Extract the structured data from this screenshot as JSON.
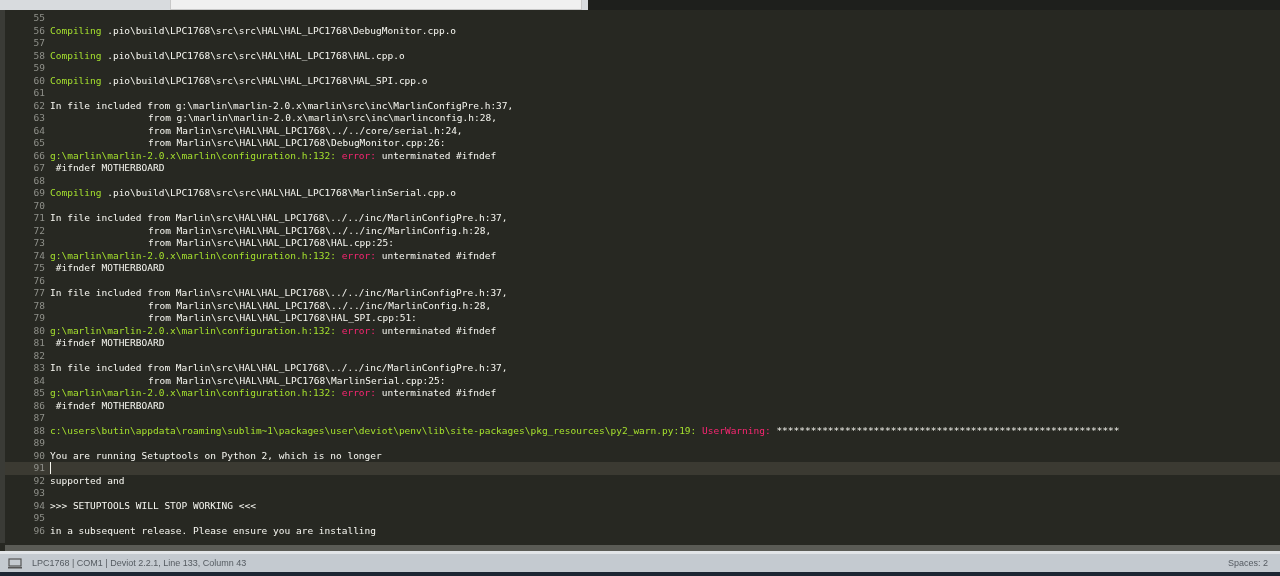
{
  "lines": [
    {
      "number": "55"
    },
    {
      "number": "56",
      "segments": [
        {
          "kind": "keyword",
          "text": "Compiling"
        },
        {
          "kind": "plain",
          "text": " .pio\\build\\LPC1768\\src\\src\\HAL\\HAL_LPC1768\\DebugMonitor.cpp.o"
        }
      ]
    },
    {
      "number": "57"
    },
    {
      "number": "58",
      "segments": [
        {
          "kind": "keyword",
          "text": "Compiling"
        },
        {
          "kind": "plain",
          "text": " .pio\\build\\LPC1768\\src\\src\\HAL\\HAL_LPC1768\\HAL.cpp.o"
        }
      ]
    },
    {
      "number": "59"
    },
    {
      "number": "60",
      "segments": [
        {
          "kind": "keyword",
          "text": "Compiling"
        },
        {
          "kind": "plain",
          "text": " .pio\\build\\LPC1768\\src\\src\\HAL\\HAL_LPC1768\\HAL_SPI.cpp.o"
        }
      ]
    },
    {
      "number": "61"
    },
    {
      "number": "62",
      "segments": [
        {
          "kind": "plain",
          "text": "In file included from g:\\marlin\\marlin-2.0.x\\marlin\\src\\inc\\MarlinConfigPre.h:37,"
        }
      ]
    },
    {
      "number": "63",
      "indent": true,
      "segments": [
        {
          "kind": "plain",
          "text": "from g:\\marlin\\marlin-2.0.x\\marlin\\src\\inc\\marlinconfig.h:28,"
        }
      ]
    },
    {
      "number": "64",
      "indent": true,
      "segments": [
        {
          "kind": "plain",
          "text": "from Marlin\\src\\HAL\\HAL_LPC1768\\../../core/serial.h:24,"
        }
      ]
    },
    {
      "number": "65",
      "indent": true,
      "segments": [
        {
          "kind": "plain",
          "text": "from Marlin\\src\\HAL\\HAL_LPC1768\\DebugMonitor.cpp:26:"
        }
      ]
    },
    {
      "number": "66",
      "segments": [
        {
          "kind": "keyword",
          "text": "g:\\marlin\\marlin-2.0.x\\marlin\\configuration.h:132:"
        },
        {
          "kind": "error",
          "text": "error:"
        },
        {
          "kind": "plain",
          "text": " unterminated #ifndef"
        }
      ]
    },
    {
      "number": "67",
      "segments": [
        {
          "kind": "plain",
          "text": " #ifndef MOTHERBOARD"
        }
      ]
    },
    {
      "number": "68"
    },
    {
      "number": "69",
      "segments": [
        {
          "kind": "keyword",
          "text": "Compiling"
        },
        {
          "kind": "plain",
          "text": " .pio\\build\\LPC1768\\src\\src\\HAL\\HAL_LPC1768\\MarlinSerial.cpp.o"
        }
      ]
    },
    {
      "number": "70"
    },
    {
      "number": "71",
      "segments": [
        {
          "kind": "plain",
          "text": "In file included from Marlin\\src\\HAL\\HAL_LPC1768\\../../inc/MarlinConfigPre.h:37,"
        }
      ]
    },
    {
      "number": "72",
      "indent": true,
      "segments": [
        {
          "kind": "plain",
          "text": "from Marlin\\src\\HAL\\HAL_LPC1768\\../../inc/MarlinConfig.h:28,"
        }
      ]
    },
    {
      "number": "73",
      "indent": true,
      "segments": [
        {
          "kind": "plain",
          "text": "from Marlin\\src\\HAL\\HAL_LPC1768\\HAL.cpp:25:"
        }
      ]
    },
    {
      "number": "74",
      "segments": [
        {
          "kind": "keyword",
          "text": "g:\\marlin\\marlin-2.0.x\\marlin\\configuration.h:132:"
        },
        {
          "kind": "error",
          "text": "error:"
        },
        {
          "kind": "plain",
          "text": " unterminated #ifndef"
        }
      ]
    },
    {
      "number": "75",
      "segments": [
        {
          "kind": "plain",
          "text": " #ifndef MOTHERBOARD"
        }
      ]
    },
    {
      "number": "76"
    },
    {
      "number": "77",
      "segments": [
        {
          "kind": "plain",
          "text": "In file included from Marlin\\src\\HAL\\HAL_LPC1768\\../../inc/MarlinConfigPre.h:37,"
        }
      ]
    },
    {
      "number": "78",
      "indent": true,
      "segments": [
        {
          "kind": "plain",
          "text": "from Marlin\\src\\HAL\\HAL_LPC1768\\../../inc/MarlinConfig.h:28,"
        }
      ]
    },
    {
      "number": "79",
      "indent": true,
      "segments": [
        {
          "kind": "plain",
          "text": "from Marlin\\src\\HAL\\HAL_LPC1768\\HAL_SPI.cpp:51:"
        }
      ]
    },
    {
      "number": "80",
      "segments": [
        {
          "kind": "keyword",
          "text": "g:\\marlin\\marlin-2.0.x\\marlin\\configuration.h:132:"
        },
        {
          "kind": "error",
          "text": "error:"
        },
        {
          "kind": "plain",
          "text": " unterminated #ifndef"
        }
      ]
    },
    {
      "number": "81",
      "segments": [
        {
          "kind": "plain",
          "text": " #ifndef MOTHERBOARD"
        }
      ]
    },
    {
      "number": "82"
    },
    {
      "number": "83",
      "segments": [
        {
          "kind": "plain",
          "text": "In file included from Marlin\\src\\HAL\\HAL_LPC1768\\../../inc/MarlinConfigPre.h:37,"
        }
      ]
    },
    {
      "number": "84",
      "indent": true,
      "segments": [
        {
          "kind": "plain",
          "text": "from Marlin\\src\\HAL\\HAL_LPC1768\\MarlinSerial.cpp:25:"
        }
      ]
    },
    {
      "number": "85",
      "segments": [
        {
          "kind": "keyword",
          "text": "g:\\marlin\\marlin-2.0.x\\marlin\\configuration.h:132:"
        },
        {
          "kind": "error",
          "text": "error:"
        },
        {
          "kind": "plain",
          "text": " unterminated #ifndef"
        }
      ]
    },
    {
      "number": "86",
      "segments": [
        {
          "kind": "plain",
          "text": " #ifndef MOTHERBOARD"
        }
      ]
    },
    {
      "number": "87"
    },
    {
      "number": "88",
      "segments": [
        {
          "kind": "keyword",
          "text": "c:\\users\\butin\\appdata\\roaming\\sublim~1\\packages\\user\\deviot\\penv\\lib\\site-packages\\pkg_resources\\py2_warn.py:19:"
        },
        {
          "kind": "error",
          "text": "UserWarning:"
        },
        {
          "kind": "plain",
          "text": " ************************************************************"
        }
      ]
    },
    {
      "number": "89"
    },
    {
      "number": "90",
      "segments": [
        {
          "kind": "plain",
          "text": "You are running Setuptools on Python 2, which is no longer"
        }
      ]
    },
    {
      "number": "91",
      "current": true
    },
    {
      "number": "92",
      "segments": [
        {
          "kind": "plain",
          "text": "supported and"
        }
      ]
    },
    {
      "number": "93"
    },
    {
      "number": "94",
      "segments": [
        {
          "kind": "plain",
          "text": ">>> SETUPTOOLS WILL STOP WORKING <<<"
        }
      ]
    },
    {
      "number": "95"
    },
    {
      "number": "96",
      "segments": [
        {
          "kind": "plain",
          "text": "in a subsequent release. Please ensure you are installing"
        }
      ]
    }
  ],
  "status_bar": {
    "left": "LPC1768 | COM1 | Deviot 2.2.1, Line 133, Column 43",
    "right": "Spaces: 2"
  }
}
